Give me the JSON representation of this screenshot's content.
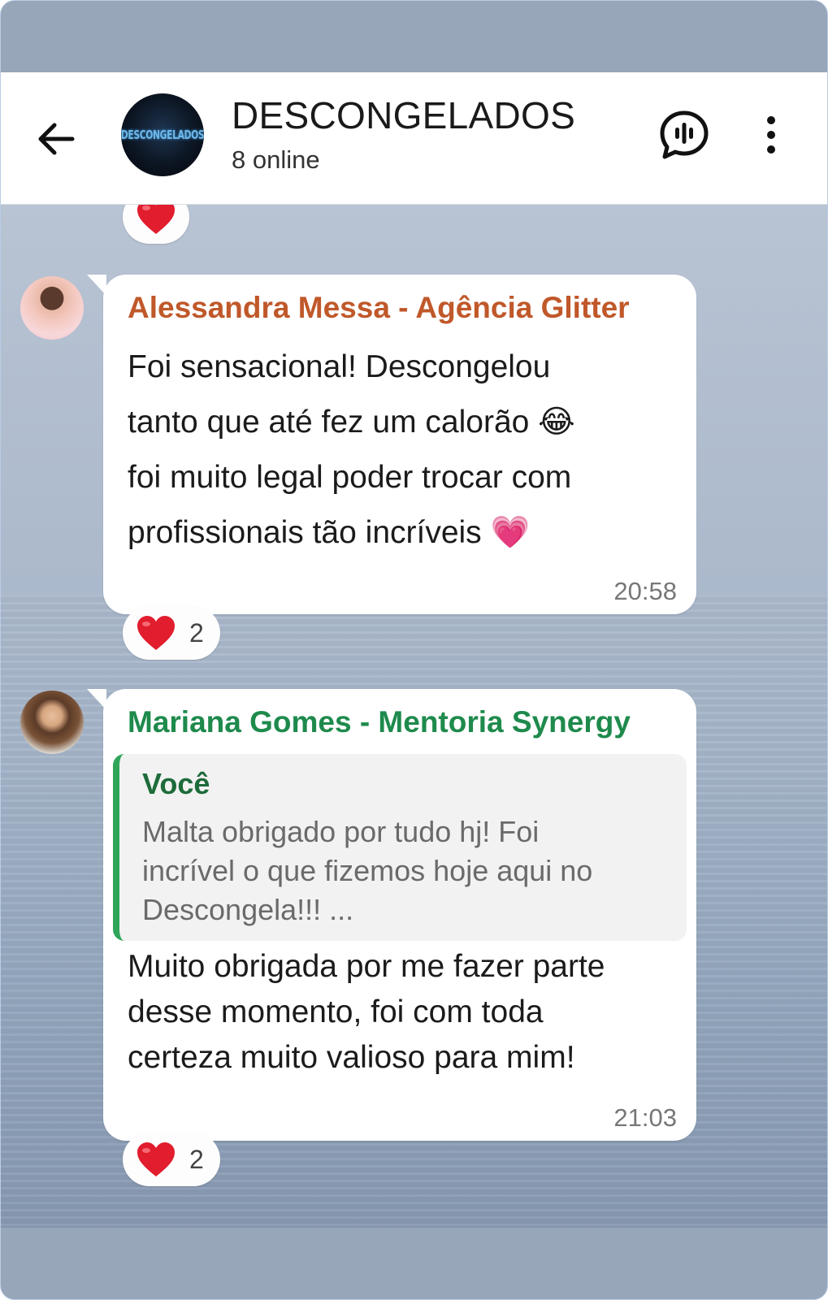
{
  "header": {
    "title": "DESCONGELADOS",
    "status": "8 online",
    "avatar_logo_text": "DESCONGELADOS"
  },
  "messages": [
    {
      "sender": "Alessandra Messa - Agência Glitter",
      "sender_color": "#c0582a",
      "text": "Foi sensacional! Descongelou\ntanto que até fez um calorão 😂\nfoi muito legal poder trocar com\nprofissionais tão incríveis 💗",
      "time": "20:58",
      "reaction": {
        "emoji": "heart",
        "count": "2"
      }
    },
    {
      "sender": "Mariana Gomes - Mentoria Synergy",
      "sender_color": "#1e8a4c",
      "quote": {
        "author": "Você",
        "text": "Malta obrigado por tudo hj! Foi\nincrível o que fizemos hoje aqui no\nDescongela!!! ..."
      },
      "text": "Muito obrigada por me fazer parte\ndesse momento, foi com toda\ncerteza muito valioso para mim!",
      "time": "21:03",
      "reaction": {
        "emoji": "heart",
        "count": "2"
      }
    }
  ],
  "colors": {
    "heart": "#e11d2e",
    "quote_bar": "#2fa55a",
    "chat_bg": "#a9b7c9"
  }
}
